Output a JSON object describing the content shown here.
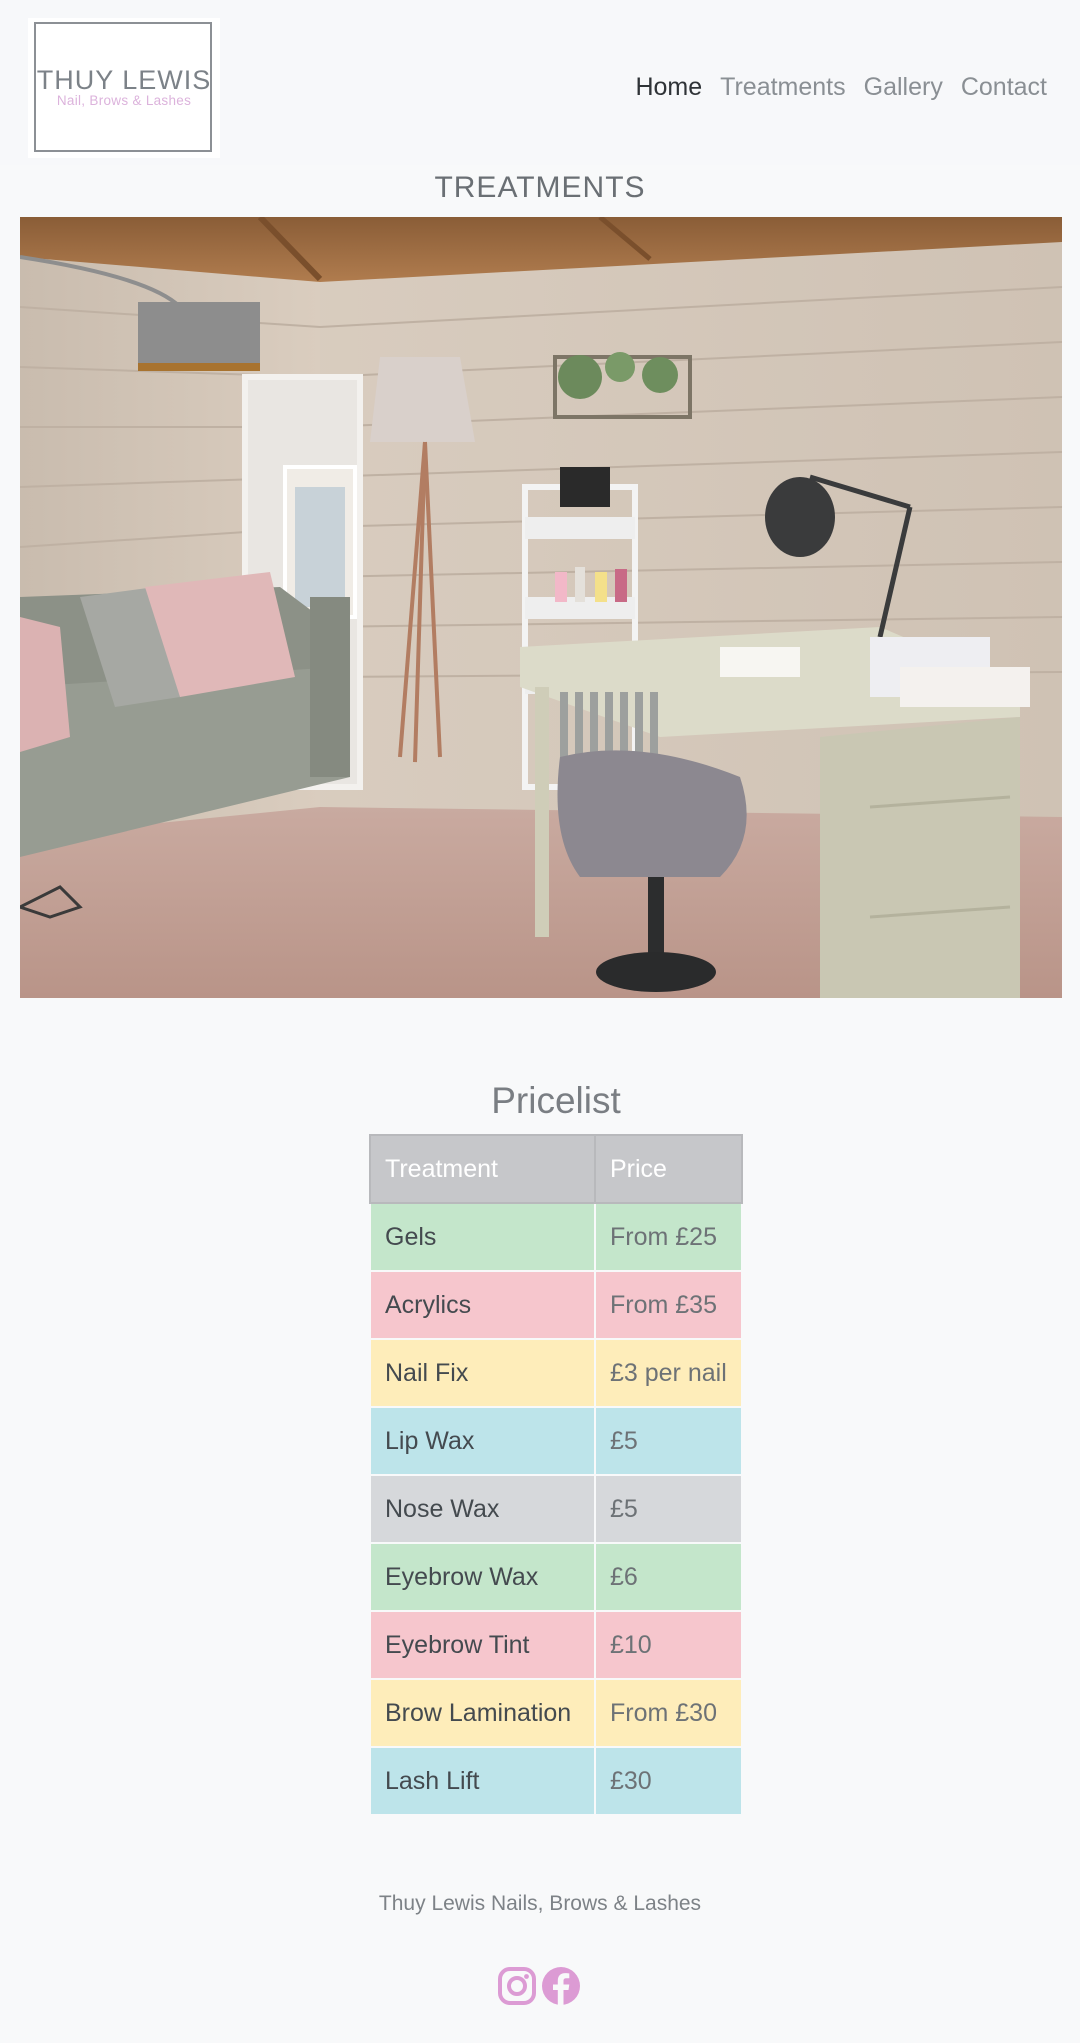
{
  "logo": {
    "title": "THUY LEWIS",
    "subtitle": "Nail, Brows & Lashes"
  },
  "nav": {
    "items": [
      {
        "label": "Home",
        "active": true
      },
      {
        "label": "Treatments",
        "active": false
      },
      {
        "label": "Gallery",
        "active": false
      },
      {
        "label": "Contact",
        "active": false
      }
    ]
  },
  "page": {
    "title": "TREATMENTS"
  },
  "pricelist": {
    "title": "Pricelist",
    "headers": [
      "Treatment",
      "Price"
    ],
    "rows": [
      {
        "treatment": "Gels",
        "price": "From £25",
        "color": "#c4e6cb"
      },
      {
        "treatment": "Acrylics",
        "price": "From £35",
        "color": "#f6c6cd"
      },
      {
        "treatment": "Nail Fix",
        "price": "£3 per nail",
        "color": "#feedba"
      },
      {
        "treatment": "Lip Wax",
        "price": "£5",
        "color": "#bde4ea"
      },
      {
        "treatment": "Nose Wax",
        "price": "£5",
        "color": "#d6d8db"
      },
      {
        "treatment": "Eyebrow Wax",
        "price": "£6",
        "color": "#c4e6cb"
      },
      {
        "treatment": "Eyebrow Tint",
        "price": "£10",
        "color": "#f6c6cd"
      },
      {
        "treatment": "Brow Lamination",
        "price": "From £30",
        "color": "#feedba"
      },
      {
        "treatment": "Lash Lift",
        "price": "£30",
        "color": "#bde4ea"
      }
    ]
  },
  "footer": {
    "text": "Thuy Lewis Nails, Brows & Lashes",
    "social": [
      {
        "icon": "instagram-icon",
        "color": "#dc9bd4"
      },
      {
        "icon": "facebook-icon",
        "color": "#dc9bd4"
      }
    ]
  }
}
